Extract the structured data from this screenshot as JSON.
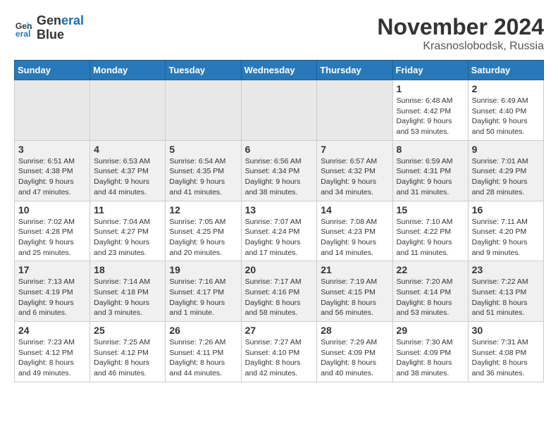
{
  "logo": {
    "line1": "General",
    "line2": "Blue"
  },
  "title": "November 2024",
  "location": "Krasnoslobodsk, Russia",
  "weekdays": [
    "Sunday",
    "Monday",
    "Tuesday",
    "Wednesday",
    "Thursday",
    "Friday",
    "Saturday"
  ],
  "weeks": [
    [
      {
        "day": "",
        "info": ""
      },
      {
        "day": "",
        "info": ""
      },
      {
        "day": "",
        "info": ""
      },
      {
        "day": "",
        "info": ""
      },
      {
        "day": "",
        "info": ""
      },
      {
        "day": "1",
        "info": "Sunrise: 6:48 AM\nSunset: 4:42 PM\nDaylight: 9 hours\nand 53 minutes."
      },
      {
        "day": "2",
        "info": "Sunrise: 6:49 AM\nSunset: 4:40 PM\nDaylight: 9 hours\nand 50 minutes."
      }
    ],
    [
      {
        "day": "3",
        "info": "Sunrise: 6:51 AM\nSunset: 4:38 PM\nDaylight: 9 hours\nand 47 minutes."
      },
      {
        "day": "4",
        "info": "Sunrise: 6:53 AM\nSunset: 4:37 PM\nDaylight: 9 hours\nand 44 minutes."
      },
      {
        "day": "5",
        "info": "Sunrise: 6:54 AM\nSunset: 4:35 PM\nDaylight: 9 hours\nand 41 minutes."
      },
      {
        "day": "6",
        "info": "Sunrise: 6:56 AM\nSunset: 4:34 PM\nDaylight: 9 hours\nand 38 minutes."
      },
      {
        "day": "7",
        "info": "Sunrise: 6:57 AM\nSunset: 4:32 PM\nDaylight: 9 hours\nand 34 minutes."
      },
      {
        "day": "8",
        "info": "Sunrise: 6:59 AM\nSunset: 4:31 PM\nDaylight: 9 hours\nand 31 minutes."
      },
      {
        "day": "9",
        "info": "Sunrise: 7:01 AM\nSunset: 4:29 PM\nDaylight: 9 hours\nand 28 minutes."
      }
    ],
    [
      {
        "day": "10",
        "info": "Sunrise: 7:02 AM\nSunset: 4:28 PM\nDaylight: 9 hours\nand 25 minutes."
      },
      {
        "day": "11",
        "info": "Sunrise: 7:04 AM\nSunset: 4:27 PM\nDaylight: 9 hours\nand 23 minutes."
      },
      {
        "day": "12",
        "info": "Sunrise: 7:05 AM\nSunset: 4:25 PM\nDaylight: 9 hours\nand 20 minutes."
      },
      {
        "day": "13",
        "info": "Sunrise: 7:07 AM\nSunset: 4:24 PM\nDaylight: 9 hours\nand 17 minutes."
      },
      {
        "day": "14",
        "info": "Sunrise: 7:08 AM\nSunset: 4:23 PM\nDaylight: 9 hours\nand 14 minutes."
      },
      {
        "day": "15",
        "info": "Sunrise: 7:10 AM\nSunset: 4:22 PM\nDaylight: 9 hours\nand 11 minutes."
      },
      {
        "day": "16",
        "info": "Sunrise: 7:11 AM\nSunset: 4:20 PM\nDaylight: 9 hours\nand 9 minutes."
      }
    ],
    [
      {
        "day": "17",
        "info": "Sunrise: 7:13 AM\nSunset: 4:19 PM\nDaylight: 9 hours\nand 6 minutes."
      },
      {
        "day": "18",
        "info": "Sunrise: 7:14 AM\nSunset: 4:18 PM\nDaylight: 9 hours\nand 3 minutes."
      },
      {
        "day": "19",
        "info": "Sunrise: 7:16 AM\nSunset: 4:17 PM\nDaylight: 9 hours\nand 1 minute."
      },
      {
        "day": "20",
        "info": "Sunrise: 7:17 AM\nSunset: 4:16 PM\nDaylight: 8 hours\nand 58 minutes."
      },
      {
        "day": "21",
        "info": "Sunrise: 7:19 AM\nSunset: 4:15 PM\nDaylight: 8 hours\nand 56 minutes."
      },
      {
        "day": "22",
        "info": "Sunrise: 7:20 AM\nSunset: 4:14 PM\nDaylight: 8 hours\nand 53 minutes."
      },
      {
        "day": "23",
        "info": "Sunrise: 7:22 AM\nSunset: 4:13 PM\nDaylight: 8 hours\nand 51 minutes."
      }
    ],
    [
      {
        "day": "24",
        "info": "Sunrise: 7:23 AM\nSunset: 4:12 PM\nDaylight: 8 hours\nand 49 minutes."
      },
      {
        "day": "25",
        "info": "Sunrise: 7:25 AM\nSunset: 4:12 PM\nDaylight: 8 hours\nand 46 minutes."
      },
      {
        "day": "26",
        "info": "Sunrise: 7:26 AM\nSunset: 4:11 PM\nDaylight: 8 hours\nand 44 minutes."
      },
      {
        "day": "27",
        "info": "Sunrise: 7:27 AM\nSunset: 4:10 PM\nDaylight: 8 hours\nand 42 minutes."
      },
      {
        "day": "28",
        "info": "Sunrise: 7:29 AM\nSunset: 4:09 PM\nDaylight: 8 hours\nand 40 minutes."
      },
      {
        "day": "29",
        "info": "Sunrise: 7:30 AM\nSunset: 4:09 PM\nDaylight: 8 hours\nand 38 minutes."
      },
      {
        "day": "30",
        "info": "Sunrise: 7:31 AM\nSunset: 4:08 PM\nDaylight: 8 hours\nand 36 minutes."
      }
    ]
  ]
}
